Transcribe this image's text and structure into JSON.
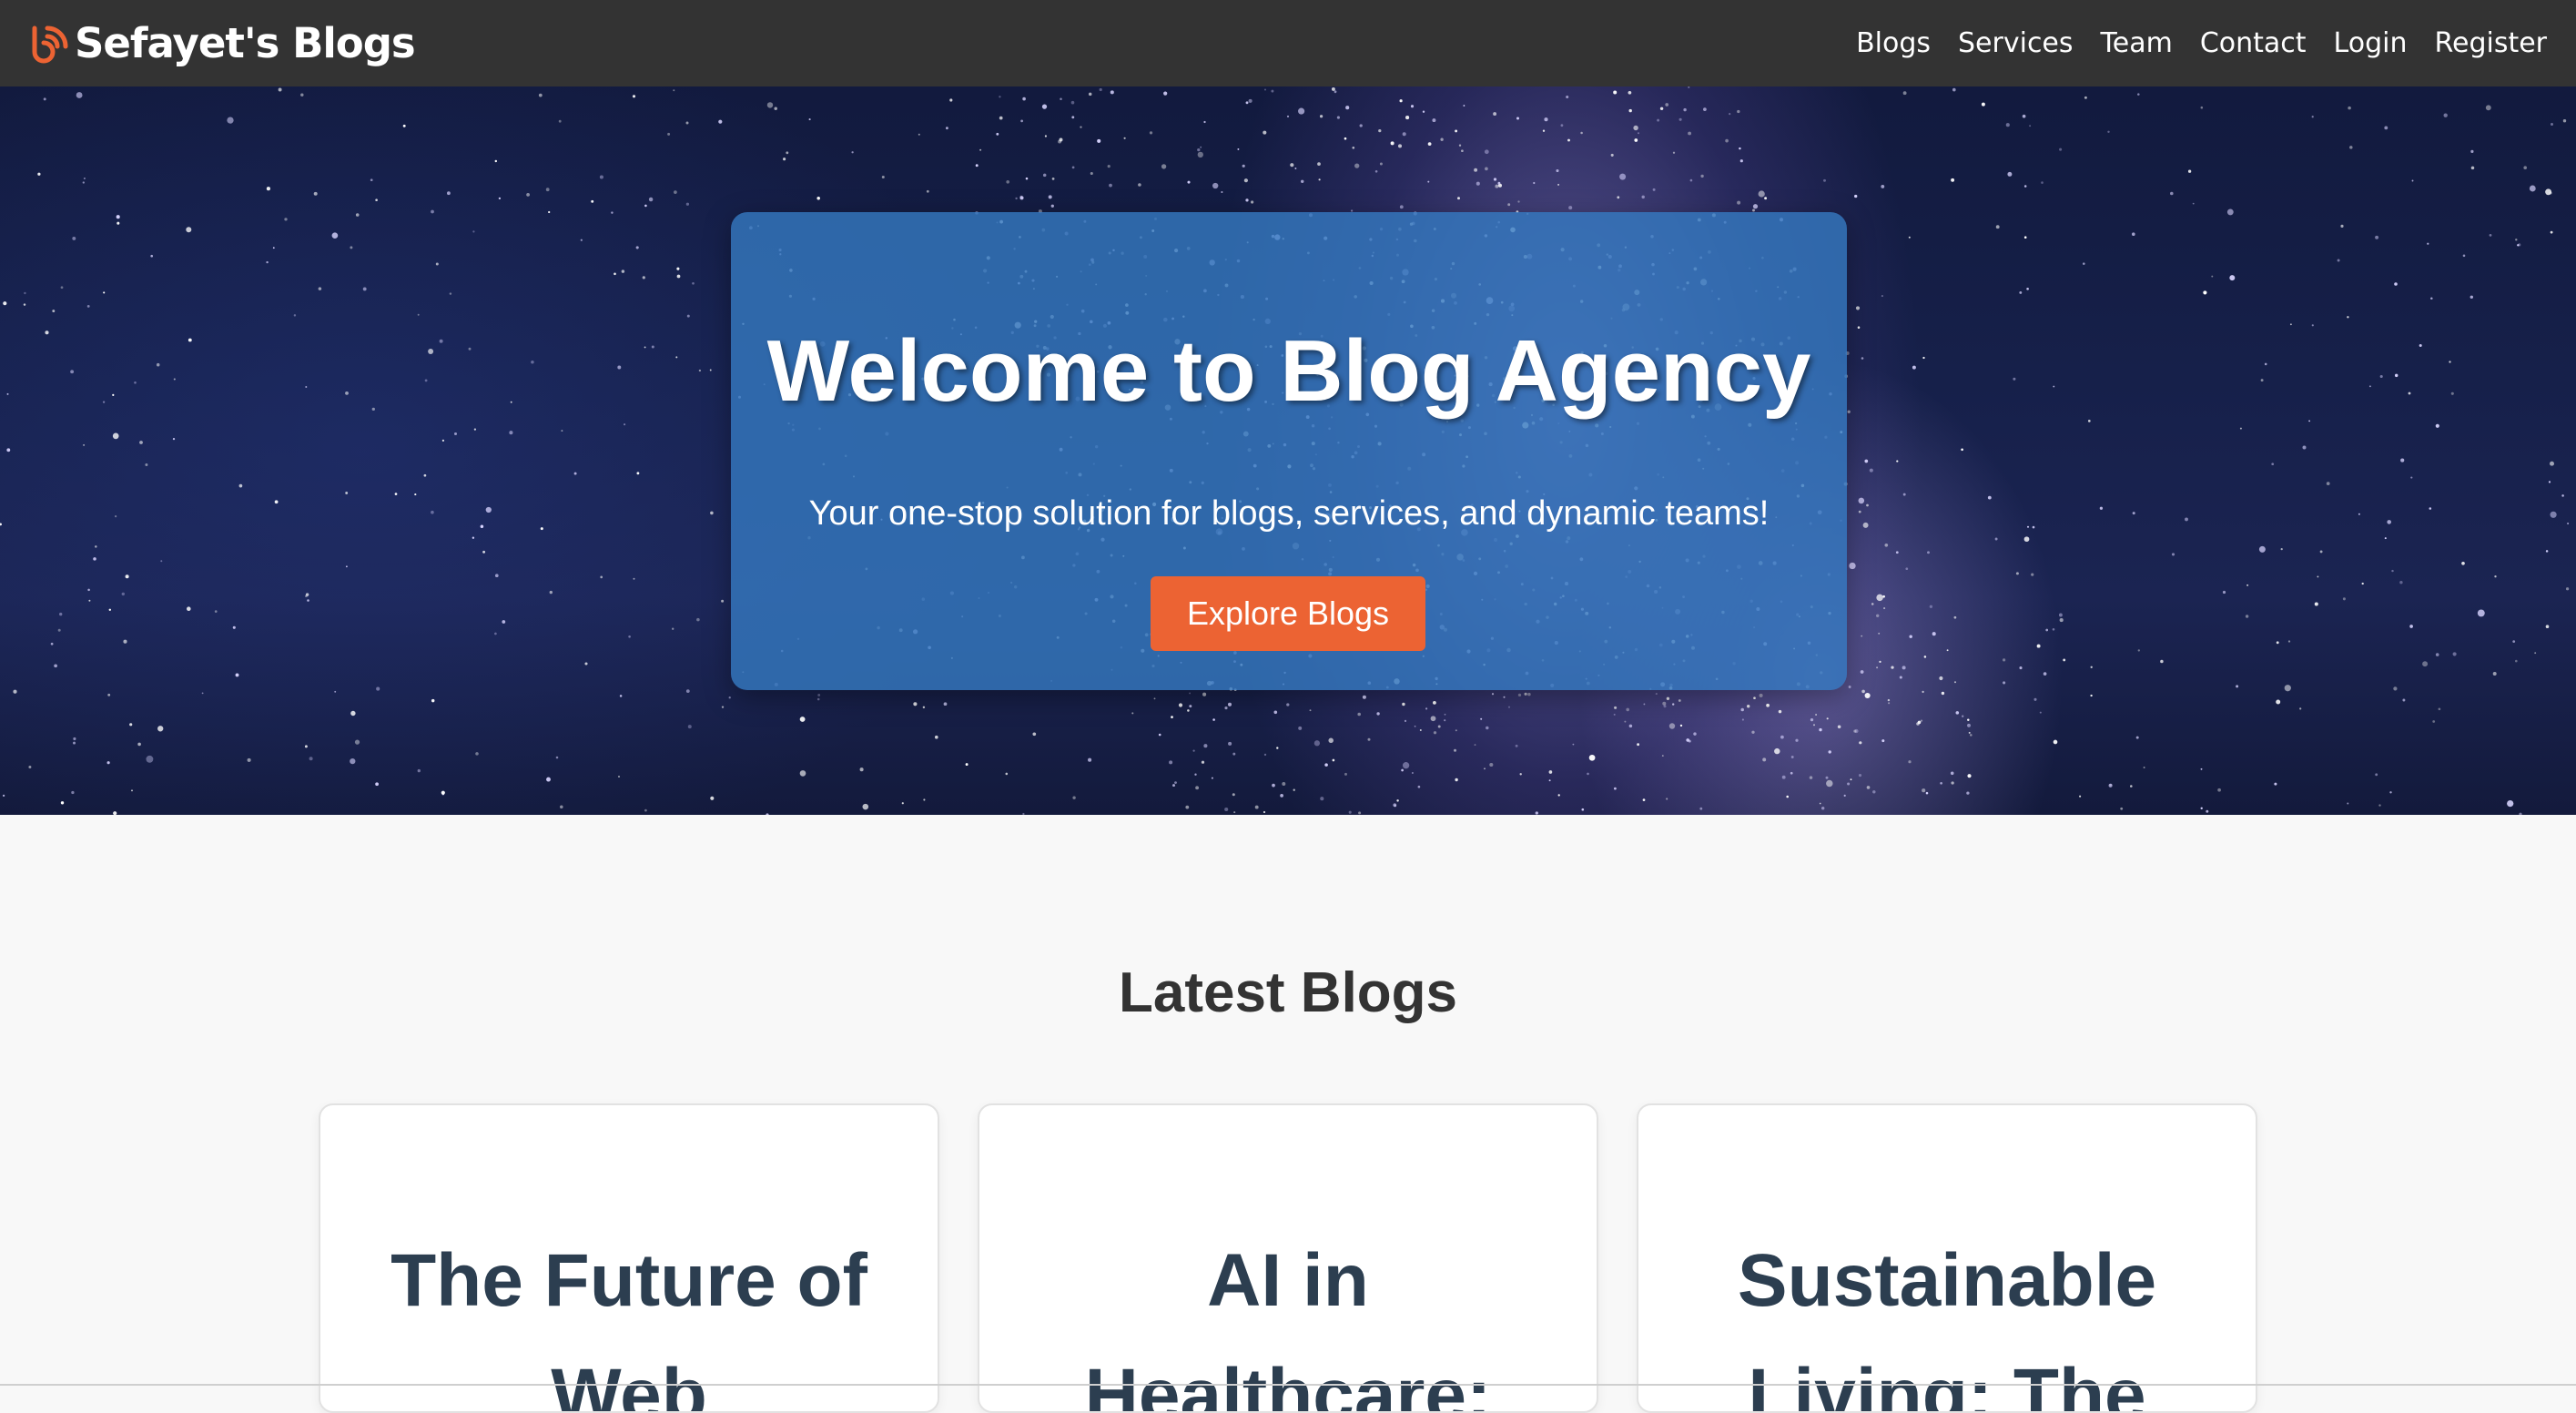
{
  "navbar": {
    "brand": "Sefayet's Blogs",
    "brand_icon": "blog-logo-icon",
    "links": [
      "Blogs",
      "Services",
      "Team",
      "Contact",
      "Login",
      "Register"
    ]
  },
  "hero": {
    "title": "Welcome to Blog Agency",
    "subtitle": "Your one-stop solution for blogs, services, and dynamic teams!",
    "button_label": "Explore Blogs"
  },
  "latest_blogs": {
    "title": "Latest Blogs",
    "cards": [
      {
        "title": "The Future of Web"
      },
      {
        "title": "AI in Healthcare:"
      },
      {
        "title": "Sustainable Living: The"
      }
    ]
  },
  "colors": {
    "navbar_bg": "#333333",
    "accent": "#ec6333",
    "hero_card": "#3478be",
    "card_title": "#2c3e50",
    "page_bg": "#f8f8f8"
  }
}
